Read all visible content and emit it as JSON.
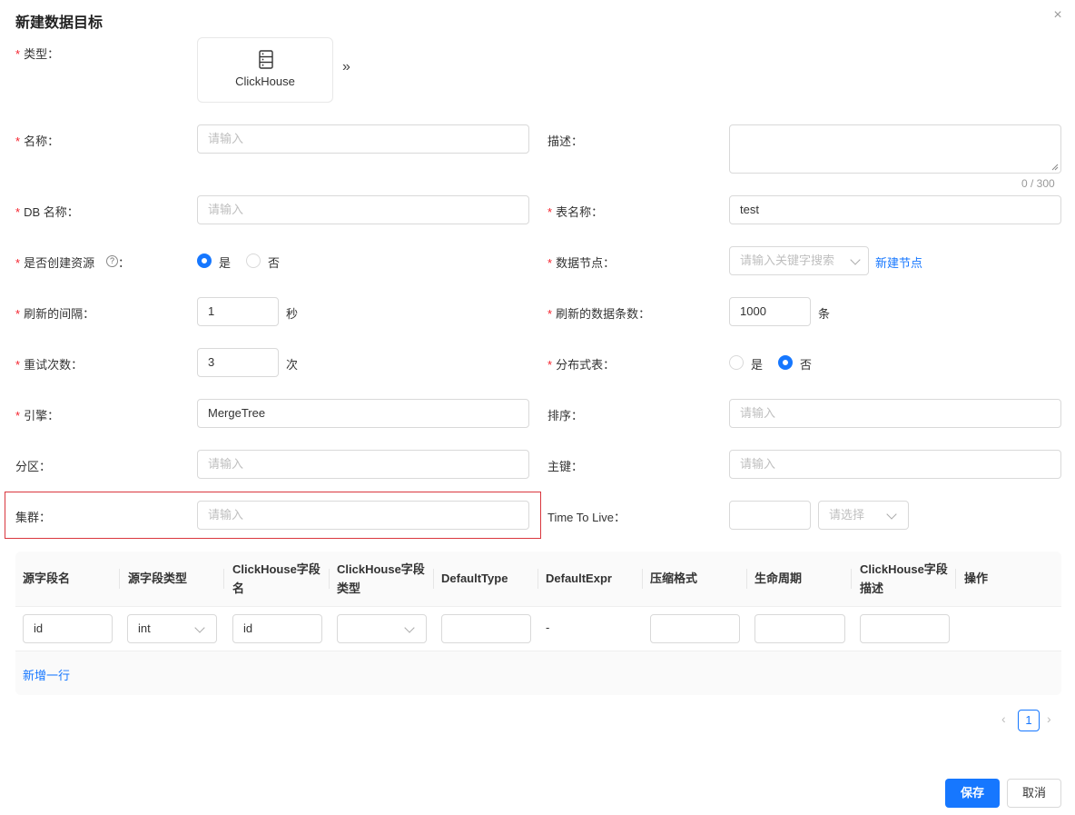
{
  "dialog": {
    "title": "新建数据目标",
    "close": "×",
    "required_mark": "*"
  },
  "type_field": {
    "label": "类型：",
    "card_name": "ClickHouse",
    "card_icon": "server-icon",
    "more_icon": "»"
  },
  "fields": {
    "name": {
      "label": "名称：",
      "placeholder": "请输入"
    },
    "desc": {
      "label": "描述：",
      "counter": "0 / 300"
    },
    "db_name": {
      "label": "DB 名称：",
      "placeholder": "请输入"
    },
    "table_name": {
      "label": "表名称：",
      "value": "test"
    },
    "create_resource": {
      "label": "是否创建资源",
      "colon": "：",
      "yes": "是",
      "no": "否",
      "selected": "yes"
    },
    "data_node": {
      "label": "数据节点：",
      "placeholder": "请输入关键字搜索",
      "new_node_link": "新建节点"
    },
    "refresh_interval": {
      "label": "刷新的间隔：",
      "value": "1",
      "unit": "秒"
    },
    "refresh_count": {
      "label": "刷新的数据条数：",
      "value": "1000",
      "unit": "条"
    },
    "retry_count": {
      "label": "重试次数：",
      "value": "3",
      "unit": "次"
    },
    "distributed_table": {
      "label": "分布式表：",
      "yes": "是",
      "no": "否",
      "selected": "no"
    },
    "engine": {
      "label": "引擎：",
      "value": "MergeTree"
    },
    "order": {
      "label": "排序：",
      "placeholder": "请输入"
    },
    "partition": {
      "label": "分区：",
      "placeholder": "请输入"
    },
    "primary_key": {
      "label": "主键：",
      "placeholder": "请输入"
    },
    "cluster": {
      "label": "集群：",
      "placeholder": "请输入"
    },
    "ttl": {
      "label": "Time To Live：",
      "select_placeholder": "请选择"
    }
  },
  "table": {
    "headers": [
      {
        "l1": "源字段名",
        "l2": ""
      },
      {
        "l1": "源字段类型",
        "l2": ""
      },
      {
        "l1": "ClickHouse字段",
        "l2": "名"
      },
      {
        "l1": "ClickHouse字段",
        "l2": "类型"
      },
      {
        "l1": "DefaultType",
        "l2": ""
      },
      {
        "l1": "DefaultExpr",
        "l2": ""
      },
      {
        "l1": "压缩格式",
        "l2": ""
      },
      {
        "l1": "生命周期",
        "l2": ""
      },
      {
        "l1": "ClickHouse字段",
        "l2": "描述"
      },
      {
        "l1": "操作",
        "l2": ""
      }
    ],
    "row": {
      "source_name": "id",
      "source_type": "int",
      "ch_name": "id",
      "ch_type": "",
      "default_type": "",
      "default_expr": "-",
      "compression": "",
      "lifecycle": "",
      "ch_desc": ""
    },
    "add_row": "新增一行"
  },
  "pagination": {
    "prev": "‹",
    "page": "1",
    "next": "›"
  },
  "footer": {
    "save": "保存",
    "cancel": "取消"
  },
  "colors": {
    "primary": "#1677ff",
    "required": "#f5222d",
    "highlight_box": "#d9363e"
  }
}
